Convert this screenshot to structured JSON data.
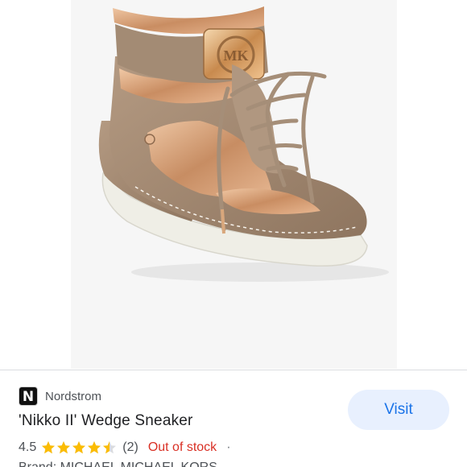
{
  "product_image": {
    "alt": "'Nikko II' Wedge Sneaker"
  },
  "result": {
    "source_icon_letter": "N",
    "source_name": "Nordstrom",
    "title": "'Nikko II' Wedge Sneaker",
    "rating": "4.5",
    "rating_value": 4.5,
    "rating_max": 5,
    "review_count": "(2)",
    "separator": "·",
    "stock_status": "Out of stock",
    "brand_line": "Brand: MICHAEL MICHAEL KORS",
    "visit_label": "Visit"
  },
  "colors": {
    "star": "#fbbc04",
    "star_empty": "#dadce0",
    "stock": "#d93025",
    "visit_bg": "#e8f0fe",
    "visit_text": "#1a73e8"
  }
}
